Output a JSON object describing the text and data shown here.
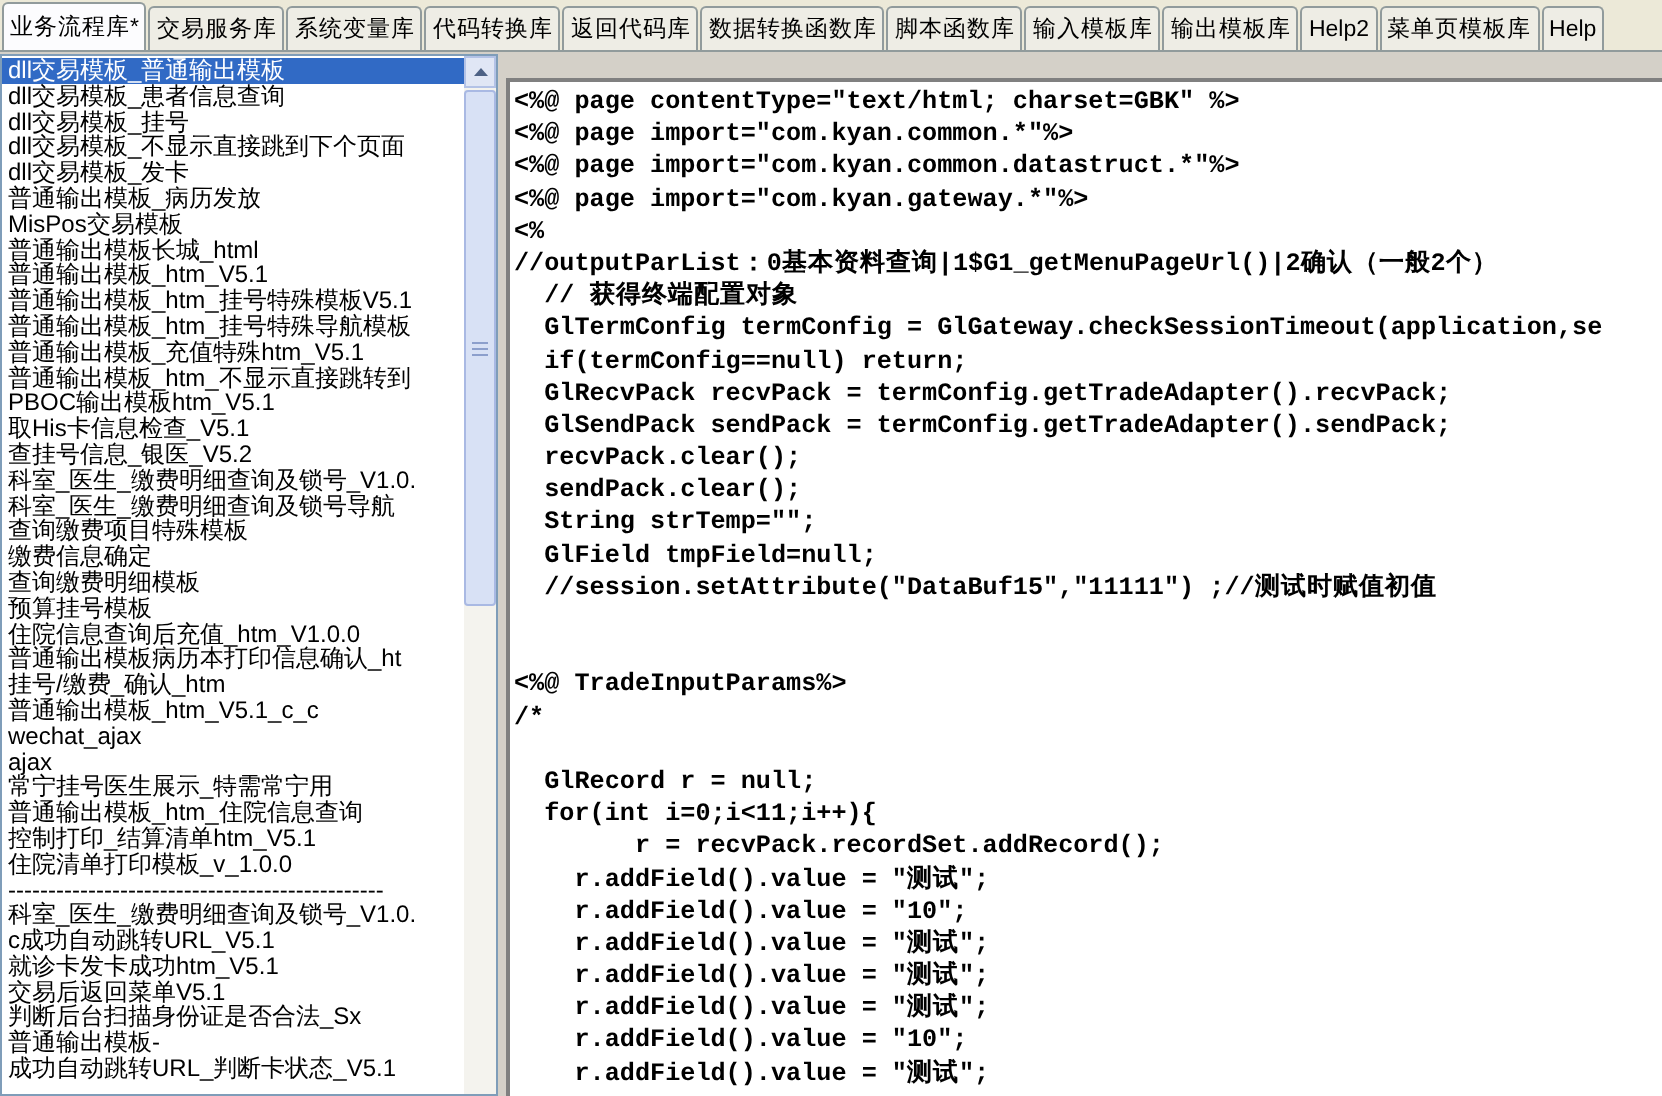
{
  "tabs": [
    {
      "label": "业务流程库*",
      "selected": true
    },
    {
      "label": "交易服务库",
      "selected": false
    },
    {
      "label": "系统变量库",
      "selected": false
    },
    {
      "label": "代码转换库",
      "selected": false
    },
    {
      "label": "返回代码库",
      "selected": false
    },
    {
      "label": "数据转换函数库",
      "selected": false
    },
    {
      "label": "脚本函数库",
      "selected": false
    },
    {
      "label": "输入模板库",
      "selected": false
    },
    {
      "label": "输出模板库",
      "selected": false
    },
    {
      "label": "Help2",
      "selected": false
    },
    {
      "label": "菜单页模板库",
      "selected": false
    },
    {
      "label": "Help",
      "selected": false
    }
  ],
  "template_list": [
    {
      "label": "dll交易模板_普通输出模板",
      "selected": true
    },
    {
      "label": "dll交易模板_患者信息查询",
      "selected": false
    },
    {
      "label": "dll交易模板_挂号",
      "selected": false
    },
    {
      "label": "dll交易模板_不显示直接跳到下个页面",
      "selected": false
    },
    {
      "label": "dll交易模板_发卡",
      "selected": false
    },
    {
      "label": "普通输出模板_病历发放",
      "selected": false
    },
    {
      "label": "MisPos交易模板",
      "selected": false
    },
    {
      "label": "普通输出模板长城_html",
      "selected": false
    },
    {
      "label": "普通输出模板_htm_V5.1",
      "selected": false
    },
    {
      "label": "普通输出模板_htm_挂号特殊模板V5.1",
      "selected": false
    },
    {
      "label": "普通输出模板_htm_挂号特殊导航模板",
      "selected": false
    },
    {
      "label": "普通输出模板_充值特殊htm_V5.1",
      "selected": false
    },
    {
      "label": "普通输出模板_htm_不显示直接跳转到",
      "selected": false
    },
    {
      "label": "PBOC输出模板htm_V5.1",
      "selected": false
    },
    {
      "label": "取His卡信息检查_V5.1",
      "selected": false
    },
    {
      "label": "查挂号信息_银医_V5.2",
      "selected": false
    },
    {
      "label": "科室_医生_缴费明细查询及锁号_V1.0.",
      "selected": false
    },
    {
      "label": "科室_医生_缴费明细查询及锁号导航",
      "selected": false
    },
    {
      "label": "查询缴费项目特殊模板",
      "selected": false
    },
    {
      "label": "缴费信息确定",
      "selected": false
    },
    {
      "label": "查询缴费明细模板",
      "selected": false
    },
    {
      "label": "预算挂号模板",
      "selected": false
    },
    {
      "label": "住院信息查询后充值_htm_V1.0.0",
      "selected": false
    },
    {
      "label": "普通输出模板病历本打印信息确认_ht",
      "selected": false
    },
    {
      "label": "挂号/缴费_确认_htm",
      "selected": false
    },
    {
      "label": "普通输出模板_htm_V5.1_c_c",
      "selected": false
    },
    {
      "label": "wechat_ajax",
      "selected": false
    },
    {
      "label": "ajax",
      "selected": false
    },
    {
      "label": "常宁挂号医生展示_特需常宁用",
      "selected": false
    },
    {
      "label": "普通输出模板_htm_住院信息查询",
      "selected": false
    },
    {
      "label": "控制打印_结算清单htm_V5.1",
      "selected": false
    },
    {
      "label": "住院清单打印模板_v_1.0.0",
      "selected": false
    },
    {
      "label": "-----------------------------------------------",
      "selected": false
    },
    {
      "label": "科室_医生_缴费明细查询及锁号_V1.0.",
      "selected": false
    },
    {
      "label": "c成功自动跳转URL_V5.1",
      "selected": false
    },
    {
      "label": "就诊卡发卡成功htm_V5.1",
      "selected": false
    },
    {
      "label": "交易后返回菜单V5.1",
      "selected": false
    },
    {
      "label": "判断后台扫描身份证是否合法_Sx",
      "selected": false
    },
    {
      "label": "普通输出模板-",
      "selected": false
    },
    {
      "label": "成功自动跳转URL_判断卡状态_V5.1",
      "selected": false
    }
  ],
  "code_lines": [
    {
      "kind": "code",
      "text": "<%@ page contentType=\"text/html; charset=GBK\" %>"
    },
    {
      "kind": "code",
      "text": "<%@ page import=\"com.kyan.common.*\"%>"
    },
    {
      "kind": "code",
      "text": "<%@ page import=\"com.kyan.common.datastruct.*\"%>"
    },
    {
      "kind": "code",
      "text": "<%@ page import=\"com.kyan.gateway.*\"%>"
    },
    {
      "kind": "code",
      "text": "<%"
    },
    {
      "kind": "code",
      "text": "//outputParList：0基本资料查询|1$G1_getMenuPageUrl()|2确认（一般2个）"
    },
    {
      "kind": "code",
      "text": "  // 获得终端配置对象"
    },
    {
      "kind": "code",
      "text": "  GlTermConfig termConfig = GlGateway.checkSessionTimeout(application,se"
    },
    {
      "kind": "code",
      "text": "  if(termConfig==null) return;"
    },
    {
      "kind": "code",
      "text": "  GlRecvPack recvPack = termConfig.getTradeAdapter().recvPack;"
    },
    {
      "kind": "code",
      "text": "  GlSendPack sendPack = termConfig.getTradeAdapter().sendPack;"
    },
    {
      "kind": "code",
      "text": "  recvPack.clear();"
    },
    {
      "kind": "code",
      "text": "  sendPack.clear();"
    },
    {
      "kind": "code",
      "text": "  String strTemp=\"\";"
    },
    {
      "kind": "code",
      "text": "  GlField tmpField=null;"
    },
    {
      "kind": "code",
      "text": "  //session.setAttribute(\"DataBuf15\",\"11111\") ;//测试时赋值初值"
    },
    {
      "kind": "blank"
    },
    {
      "kind": "blank"
    },
    {
      "kind": "code",
      "text": "<%@ TradeInputParams%>"
    },
    {
      "kind": "code",
      "text": "/*"
    },
    {
      "kind": "blank"
    },
    {
      "kind": "code",
      "text": "  GlRecord r = null;"
    },
    {
      "kind": "code",
      "text": "  for(int i=0;i<11;i++){"
    },
    {
      "kind": "code",
      "text": "        r = recvPack.recordSet.addRecord();"
    },
    {
      "kind": "code",
      "text": "    r.addField().value = \"测试\";"
    },
    {
      "kind": "code",
      "text": "    r.addField().value = \"10\";"
    },
    {
      "kind": "code",
      "text": "    r.addField().value = \"测试\";"
    },
    {
      "kind": "code",
      "text": "    r.addField().value = \"测试\";"
    },
    {
      "kind": "code",
      "text": "    r.addField().value = \"测试\";"
    },
    {
      "kind": "code",
      "text": "    r.addField().value = \"10\";"
    },
    {
      "kind": "code",
      "text": "    r.addField().value = \"测试\";"
    }
  ]
}
